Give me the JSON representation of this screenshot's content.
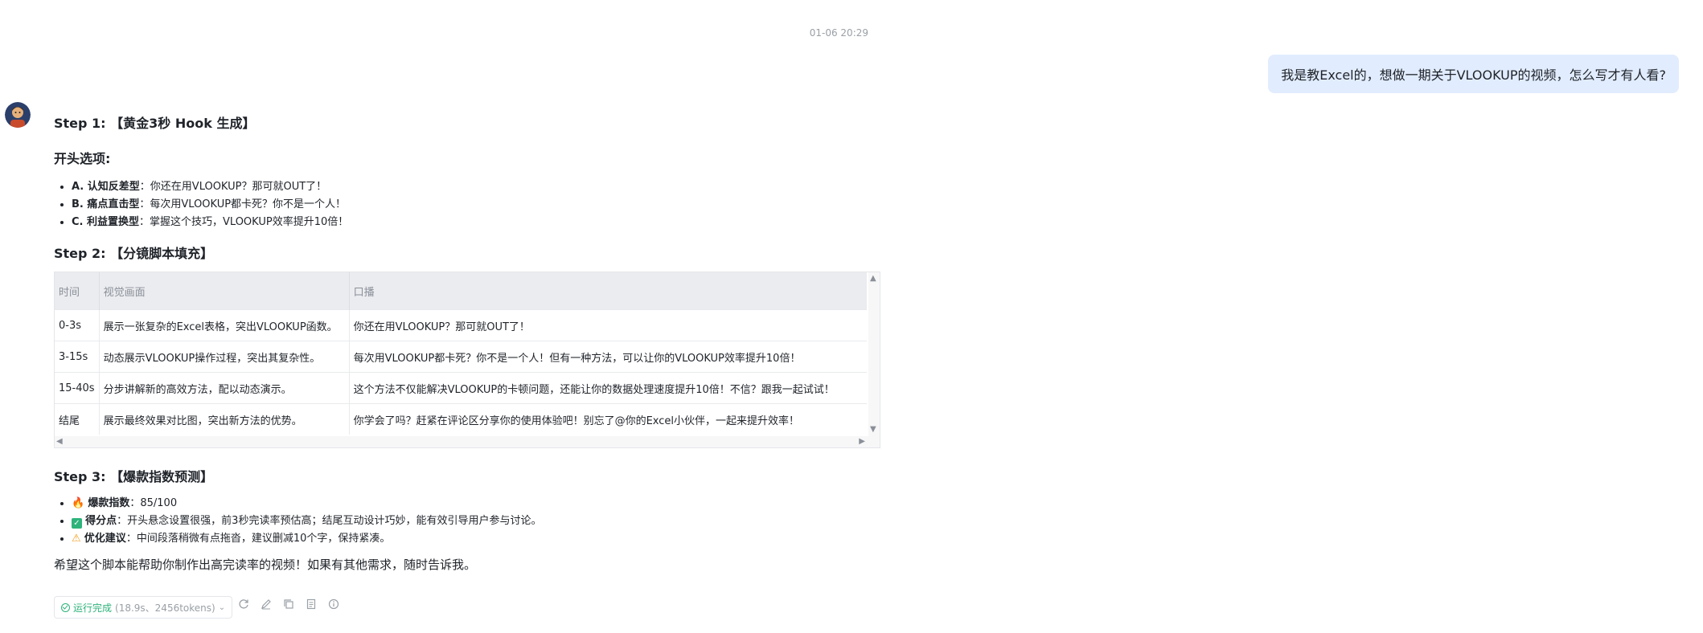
{
  "conversation": {
    "timestamp": "01-06 20:29",
    "user_message": "我是教Excel的，想做一期关于VLOOKUP的视频，怎么写才有人看?"
  },
  "answer": {
    "step1": {
      "heading": "Step 1: 【黄金3秒 Hook 生成】",
      "options_heading": "开头选项:",
      "options": [
        {
          "label": "A. 认知反差型",
          "text": "你还在用VLOOKUP？那可就OUT了！"
        },
        {
          "label": "B. 痛点直击型",
          "text": "每次用VLOOKUP都卡死？你不是一个人！"
        },
        {
          "label": "C. 利益置换型",
          "text": "掌握这个技巧，VLOOKUP效率提升10倍！"
        }
      ]
    },
    "step2": {
      "heading": "Step 2: 【分镜脚本填充】",
      "table": {
        "headers": [
          "时间",
          "视觉画面",
          "口播"
        ],
        "rows": [
          [
            "0-3s",
            "展示一张复杂的Excel表格，突出VLOOKUP函数。",
            "你还在用VLOOKUP？那可就OUT了！"
          ],
          [
            "3-15s",
            "动态展示VLOOKUP操作过程，突出其复杂性。",
            "每次用VLOOKUP都卡死？你不是一个人！但有一种方法，可以让你的VLOOKUP效率提升10倍！"
          ],
          [
            "15-40s",
            "分步讲解新的高效方法，配以动态演示。",
            "这个方法不仅能解决VLOOKUP的卡顿问题，还能让你的数据处理速度提升10倍！不信？跟我一起试试！"
          ],
          [
            "结尾",
            "展示最终效果对比图，突出新方法的优势。",
            "你学会了吗？赶紧在评论区分享你的使用体验吧！别忘了@你的Excel小伙伴，一起来提升效率！"
          ]
        ]
      }
    },
    "step3": {
      "heading": "Step 3: 【爆款指数预测】",
      "items": [
        {
          "icon": "fire-icon",
          "label": "爆款指数",
          "text": "85/100"
        },
        {
          "icon": "check-box-icon",
          "label": "得分点",
          "text": "开头悬念设置很强，前3秒完读率预估高；结尾互动设计巧妙，能有效引导用户参与讨论。"
        },
        {
          "icon": "warning-icon",
          "label": "优化建议",
          "text": "中间段落稍微有点拖沓，建议删减10个字，保持紧凑。"
        }
      ]
    },
    "closing": "希望这个脚本能帮助你制作出高完读率的视频！如果有其他需求，随时告诉我。"
  },
  "status": {
    "label": "运行完成",
    "detail": "(18.9s、2456tokens)"
  },
  "toolbar_icons": [
    "refresh-icon",
    "edit-icon",
    "copy-icon",
    "document-icon",
    "info-icon"
  ],
  "colors": {
    "accent_green": "#2db37b",
    "user_bubble": "#e1ecfe"
  }
}
